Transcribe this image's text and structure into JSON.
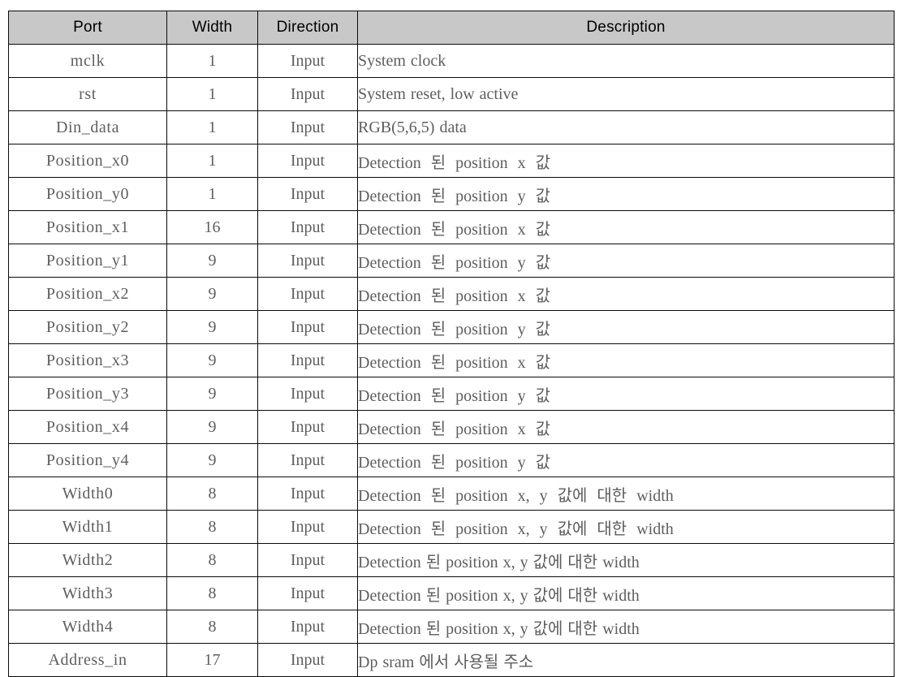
{
  "table": {
    "columns": [
      "Port",
      "Width",
      "Direction",
      "Description"
    ],
    "rows": [
      {
        "port": "mclk",
        "width": "1",
        "direction": "Input",
        "description": "System clock",
        "spacing": "tight"
      },
      {
        "port": "rst",
        "width": "1",
        "direction": "Input",
        "description": "System reset, low active",
        "spacing": "tight"
      },
      {
        "port": "Din_data",
        "width": "1",
        "direction": "Input",
        "description": "RGB(5,6,5) data",
        "spacing": "tight"
      },
      {
        "port": "Position_x0",
        "width": "1",
        "direction": "Input",
        "description": "Detection 된 position x 값",
        "spacing": "wide"
      },
      {
        "port": "Position_y0",
        "width": "1",
        "direction": "Input",
        "description": "Detection 된 position y 값",
        "spacing": "wide"
      },
      {
        "port": "Position_x1",
        "width": "16",
        "direction": "Input",
        "description": "Detection 된 position x 값",
        "spacing": "wide"
      },
      {
        "port": "Position_y1",
        "width": "9",
        "direction": "Input",
        "description": "Detection 된 position y 값",
        "spacing": "wide"
      },
      {
        "port": "Position_x2",
        "width": "9",
        "direction": "Input",
        "description": "Detection 된 position x 값",
        "spacing": "wide"
      },
      {
        "port": "Position_y2",
        "width": "9",
        "direction": "Input",
        "description": "Detection 된 position y 값",
        "spacing": "wide"
      },
      {
        "port": "Position_x3",
        "width": "9",
        "direction": "Input",
        "description": "Detection 된 position x 값",
        "spacing": "wide"
      },
      {
        "port": "Position_y3",
        "width": "9",
        "direction": "Input",
        "description": "Detection 된 position y 값",
        "spacing": "wide"
      },
      {
        "port": "Position_x4",
        "width": "9",
        "direction": "Input",
        "description": "Detection 된 position x 값",
        "spacing": "wide"
      },
      {
        "port": "Position_y4",
        "width": "9",
        "direction": "Input",
        "description": "Detection 된 position y 값",
        "spacing": "wide"
      },
      {
        "port": "Width0",
        "width": "8",
        "direction": "Input",
        "description": "Detection 된 position x, y 값에 대한 width",
        "spacing": "wide"
      },
      {
        "port": "Width1",
        "width": "8",
        "direction": "Input",
        "description": "Detection 된 position x, y 값에 대한 width",
        "spacing": "wide"
      },
      {
        "port": "Width2",
        "width": "8",
        "direction": "Input",
        "description": "Detection 된 position x, y 값에 대한 width",
        "spacing": "tight"
      },
      {
        "port": "Width3",
        "width": "8",
        "direction": "Input",
        "description": "Detection 된 position x, y 값에 대한 width",
        "spacing": "tight"
      },
      {
        "port": "Width4",
        "width": "8",
        "direction": "Input",
        "description": "Detection 된 position x, y 값에 대한 width",
        "spacing": "tight"
      },
      {
        "port": "Address_in",
        "width": "17",
        "direction": "Input",
        "description": "Dp sram 에서 사용될 주소",
        "spacing": "tight"
      }
    ]
  },
  "colors": {
    "header_fill": "#c8c8c8",
    "border": "#0a0a0a",
    "header_text": "#000000",
    "body_text": "#5e5e5e",
    "page_background": "#ffffff"
  }
}
